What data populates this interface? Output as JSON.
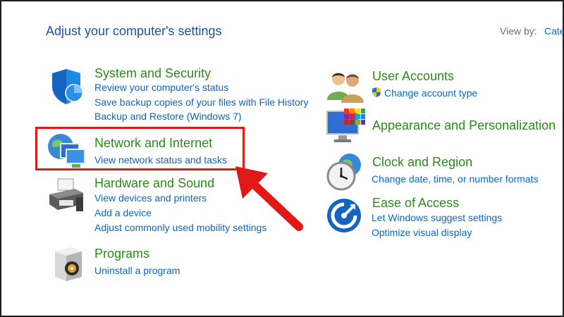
{
  "header": {
    "title": "Adjust your computer's settings",
    "view_by_label": "View by:",
    "view_by_value": "Cate"
  },
  "left_categories": [
    {
      "title": "System and Security",
      "icon": "shield-icon",
      "links": [
        "Review your computer's status",
        "Save backup copies of your files with File History",
        "Backup and Restore (Windows 7)"
      ]
    },
    {
      "title": "Network and Internet",
      "icon": "network-globe-icon",
      "links": [
        "View network status and tasks"
      ]
    },
    {
      "title": "Hardware and Sound",
      "icon": "printer-icon",
      "links": [
        "View devices and printers",
        "Add a device",
        "Adjust commonly used mobility settings"
      ]
    },
    {
      "title": "Programs",
      "icon": "programs-box-icon",
      "links": [
        "Uninstall a program"
      ]
    }
  ],
  "right_categories": [
    {
      "title": "User Accounts",
      "icon": "users-icon",
      "links": [
        "Change account type"
      ]
    },
    {
      "title": "Appearance and Personalization",
      "icon": "monitor-palette-icon",
      "links": []
    },
    {
      "title": "Clock and Region",
      "icon": "clock-globe-icon",
      "links": [
        "Change date, time, or number formats"
      ]
    },
    {
      "title": "Ease of Access",
      "icon": "ease-of-access-icon",
      "links": [
        "Let Windows suggest settings",
        "Optimize visual display"
      ]
    }
  ],
  "colors": {
    "title_blue": "#1e4f9c",
    "category_green": "#2b8a1a",
    "link_blue": "#0a66c2",
    "highlight_red": "#e01818"
  }
}
